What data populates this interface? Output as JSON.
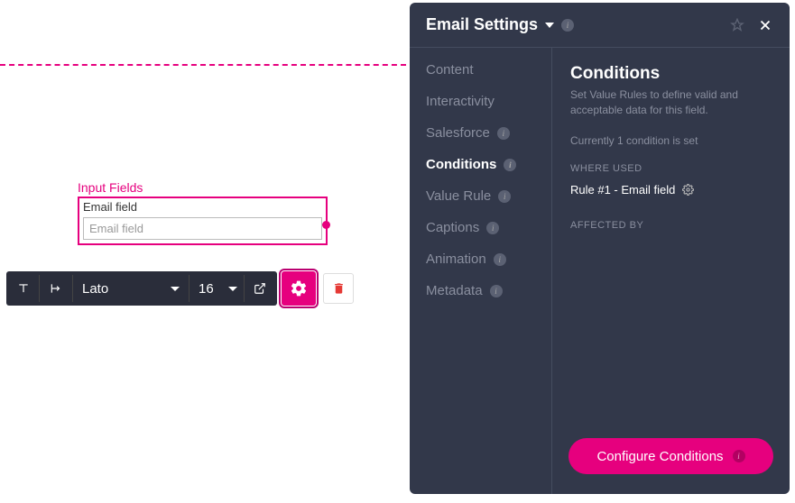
{
  "canvas": {
    "field_group_label": "Input Fields",
    "field_title": "Email field",
    "field_placeholder": "Email field"
  },
  "toolbar": {
    "font_family": "Lato",
    "font_size": "16"
  },
  "panel": {
    "title": "Email Settings",
    "nav": {
      "content": "Content",
      "interactivity": "Interactivity",
      "salesforce": "Salesforce",
      "conditions": "Conditions",
      "value_rule": "Value Rule",
      "captions": "Captions",
      "animation": "Animation",
      "metadata": "Metadata"
    },
    "content": {
      "title": "Conditions",
      "description": "Set Value Rules to define valid and acceptable data for this field.",
      "status": "Currently 1 condition is set",
      "where_used_label": "WHERE USED",
      "rule_text": "Rule #1 - Email field",
      "affected_by_label": "AFFECTED BY",
      "button": "Configure Conditions"
    }
  }
}
